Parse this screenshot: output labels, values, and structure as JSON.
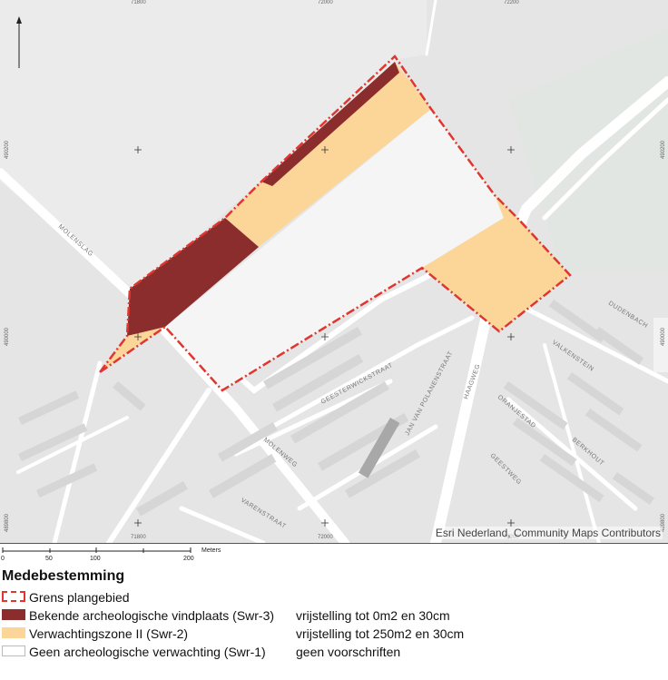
{
  "map": {
    "attribution": "Esri Nederland, Community Maps Contributors",
    "streets": [
      "MOLENSLAG",
      "MOLENWEG",
      "GEESTERWICKSTRAAT",
      "JAN VAN POLANENSTRAAT",
      "HAAGWEG",
      "DUDENBACH",
      "VALKENSTEIN",
      "VARENSTRAAT",
      "BERKHOUT",
      "ORANJESTAD",
      "GEESTWEG"
    ],
    "coordinates": {
      "x_ticks": [
        "71800",
        "72000",
        "72200"
      ],
      "y_ticks": [
        "490200",
        "490000",
        "489800"
      ]
    },
    "colors": {
      "background": "#e6e6e6",
      "boundary": "#e0362f",
      "swr3": "#8b2d2d",
      "swr2": "#fcd699",
      "swr1": "#ffffff"
    }
  },
  "scalebar": {
    "labels": [
      "0",
      "50",
      "100",
      "200"
    ],
    "unit": "Meters"
  },
  "legend": {
    "title": "Medebestemming",
    "items": [
      {
        "label": "Grens plangebied",
        "rule": ""
      },
      {
        "label": "Bekende archeologische vindplaats (Swr-3)",
        "rule": "vrijstelling tot 0m2 en 30cm"
      },
      {
        "label": "Verwachtingszone II (Swr-2)",
        "rule": "vrijstelling tot 250m2 en 30cm"
      },
      {
        "label": "Geen archeologische verwachting  (Swr-1)",
        "rule": "geen voorschriften"
      }
    ]
  }
}
